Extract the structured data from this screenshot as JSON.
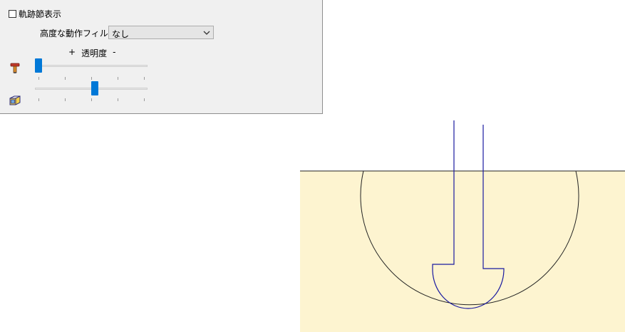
{
  "panel": {
    "trajectory_checkbox": {
      "label": "軌跡節表示",
      "checked": false
    },
    "filter": {
      "label": "高度な動作フィルタ",
      "selected": "なし"
    },
    "opacity": {
      "plus": "+",
      "label": "透明度",
      "minus": "-"
    },
    "sliders": [
      {
        "name": "tool-opacity",
        "icon": "tool-icon",
        "value_fraction": 0.0
      },
      {
        "name": "stock-opacity",
        "icon": "stock-box-icon",
        "value_fraction": 0.5
      }
    ]
  },
  "colors": {
    "panel_bg": "#f0f0f0",
    "slider_thumb": "#0078d7",
    "stock_fill": "#fdf4d0",
    "tool_outline": "#1a1aa0",
    "outline": "#222222"
  }
}
